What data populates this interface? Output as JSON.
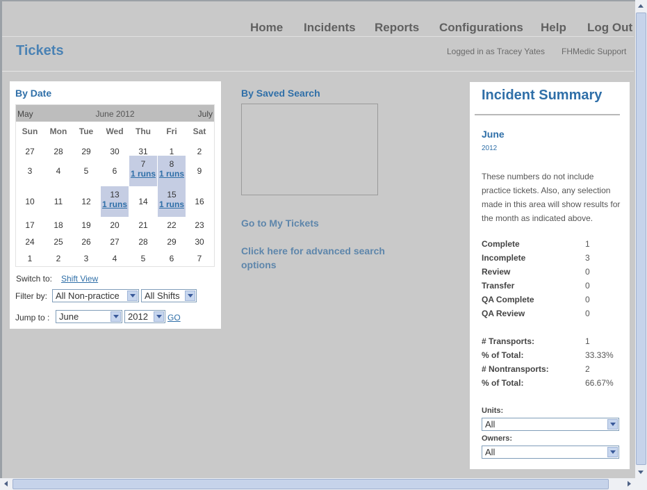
{
  "nav": {
    "items": [
      "Home",
      "Incidents",
      "Reports",
      "Configurations",
      "Help",
      "Log Out"
    ]
  },
  "header": {
    "title": "Tickets",
    "logged_in": "Logged in as Tracey Yates",
    "support": "FHMedic Support"
  },
  "by_date": {
    "heading": "By Date",
    "calendar": {
      "prev": "May",
      "title": "June 2012",
      "next": "July",
      "weekdays": [
        "Sun",
        "Mon",
        "Tue",
        "Wed",
        "Thu",
        "Fri",
        "Sat"
      ],
      "weeks": [
        [
          {
            "d": "27"
          },
          {
            "d": "28"
          },
          {
            "d": "29"
          },
          {
            "d": "30"
          },
          {
            "d": "31"
          },
          {
            "d": "1"
          },
          {
            "d": "2"
          }
        ],
        [
          {
            "d": "3"
          },
          {
            "d": "4"
          },
          {
            "d": "5"
          },
          {
            "d": "6"
          },
          {
            "d": "7",
            "runs": "1 runs"
          },
          {
            "d": "8",
            "runs": "1 runs"
          },
          {
            "d": "9"
          }
        ],
        [
          {
            "d": "10"
          },
          {
            "d": "11"
          },
          {
            "d": "12"
          },
          {
            "d": "13",
            "runs": "1 runs"
          },
          {
            "d": "14"
          },
          {
            "d": "15",
            "runs": "1 runs"
          },
          {
            "d": "16"
          }
        ],
        [
          {
            "d": "17"
          },
          {
            "d": "18"
          },
          {
            "d": "19"
          },
          {
            "d": "20"
          },
          {
            "d": "21"
          },
          {
            "d": "22"
          },
          {
            "d": "23"
          }
        ],
        [
          {
            "d": "24"
          },
          {
            "d": "25"
          },
          {
            "d": "26"
          },
          {
            "d": "27"
          },
          {
            "d": "28"
          },
          {
            "d": "29"
          },
          {
            "d": "30"
          }
        ],
        [
          {
            "d": "1"
          },
          {
            "d": "2"
          },
          {
            "d": "3"
          },
          {
            "d": "4"
          },
          {
            "d": "5"
          },
          {
            "d": "6"
          },
          {
            "d": "7"
          }
        ]
      ]
    },
    "switch_label": "Switch to:",
    "switch_link": "Shift View",
    "filter_label": "Filter by:",
    "filter_practice": "All Non-practice",
    "filter_shifts": "All Shifts",
    "jump_label": "Jump to :",
    "jump_month": "June",
    "jump_year": "2012",
    "go": "GO"
  },
  "saved_search": {
    "heading": "By Saved Search",
    "my_tickets": "Go to My Tickets",
    "advanced": "Click here for advanced search options"
  },
  "summary": {
    "title": "Incident Summary",
    "month": "June",
    "year": "2012",
    "note": "These numbers do not include practice tickets. Also, any selection made in this area will show results for the month as indicated above.",
    "stats": [
      {
        "label": "Complete",
        "value": "1"
      },
      {
        "label": "Incomplete",
        "value": "3"
      },
      {
        "label": "Review",
        "value": "0"
      },
      {
        "label": "Transfer",
        "value": "0"
      },
      {
        "label": "QA Complete",
        "value": "0"
      },
      {
        "label": "QA Review",
        "value": "0"
      }
    ],
    "transport_stats": [
      {
        "label": "# Transports:",
        "value": "1"
      },
      {
        "label": "% of Total:",
        "value": "33.33%"
      },
      {
        "label": "# Nontransports:",
        "value": "2"
      },
      {
        "label": "% of Total:",
        "value": "66.67%"
      }
    ],
    "units_label": "Units:",
    "units_value": "All",
    "owners_label": "Owners:",
    "owners_value": "All"
  }
}
